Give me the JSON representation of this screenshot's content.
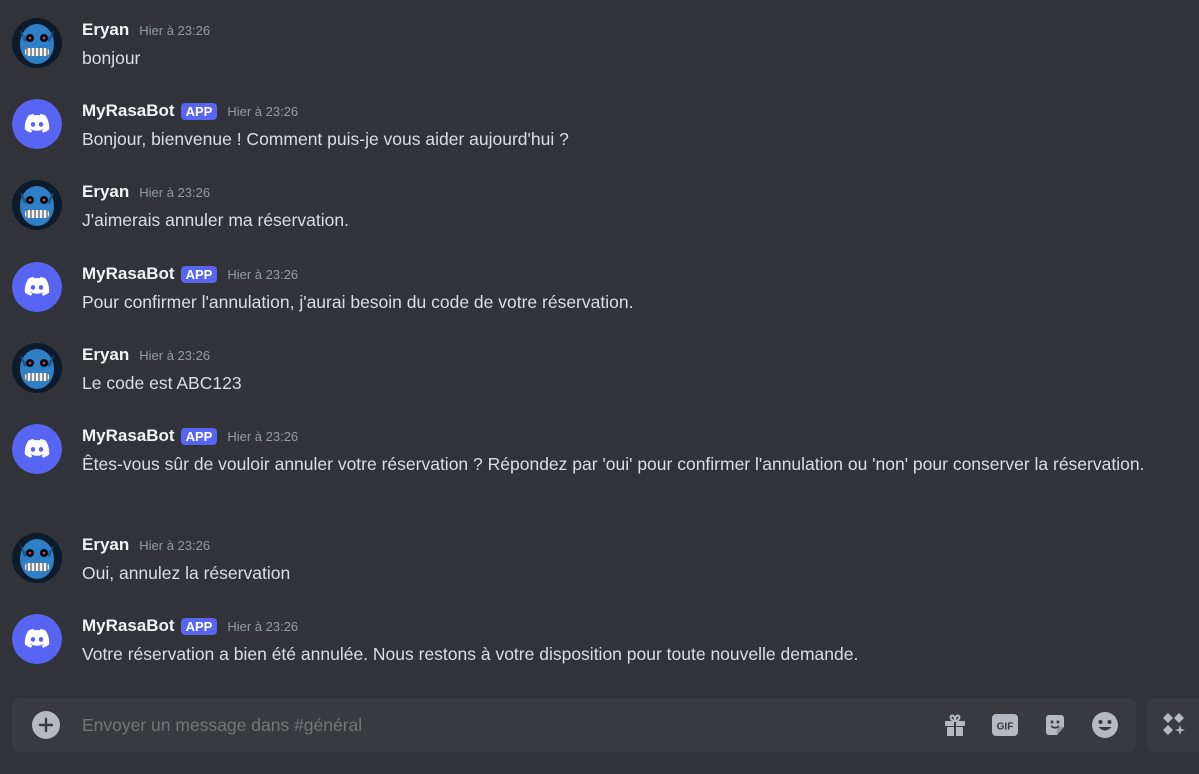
{
  "messages": [
    {
      "user": "Eryan",
      "bot": false,
      "time": "Hier à 23:26",
      "text": "bonjour"
    },
    {
      "user": "MyRasaBot",
      "bot": true,
      "badge": "APP",
      "time": "Hier à 23:26",
      "text": "Bonjour, bienvenue ! Comment puis-je vous aider aujourd'hui ?"
    },
    {
      "user": "Eryan",
      "bot": false,
      "time": "Hier à 23:26",
      "text": "J'aimerais annuler ma réservation."
    },
    {
      "user": "MyRasaBot",
      "bot": true,
      "badge": "APP",
      "time": "Hier à 23:26",
      "text": "Pour confirmer l'annulation, j'aurai besoin du code de votre réservation."
    },
    {
      "user": "Eryan",
      "bot": false,
      "time": "Hier à 23:26",
      "text": "Le code est ABC123"
    },
    {
      "user": "MyRasaBot",
      "bot": true,
      "badge": "APP",
      "time": "Hier à 23:26",
      "text": "Êtes-vous sûr de vouloir annuler votre réservation ? Répondez par 'oui' pour confirmer l'annulation ou 'non' pour conserver la réservation."
    },
    {
      "user": "Eryan",
      "bot": false,
      "time": "Hier à 23:26",
      "text": "Oui, annulez la réservation"
    },
    {
      "user": "MyRasaBot",
      "bot": true,
      "badge": "APP",
      "time": "Hier à 23:26",
      "text": "Votre réservation a bien été annulée. Nous restons à votre disposition pour toute nouvelle demande."
    }
  ],
  "composer": {
    "placeholder": "Envoyer un message dans #général",
    "gif_label": "GIF",
    "icons": [
      "add-icon",
      "gift-icon",
      "gif-icon",
      "sticker-icon",
      "emoji-icon",
      "apps-icon"
    ]
  },
  "colors": {
    "background": "#313338",
    "composer": "#383a40",
    "blurple": "#5865f2",
    "text": "#dbdee1",
    "muted": "#949ba4"
  }
}
